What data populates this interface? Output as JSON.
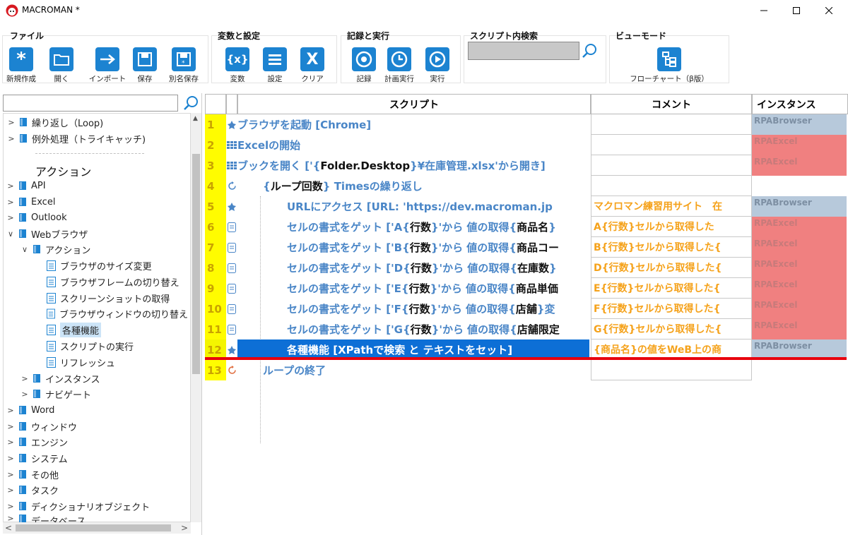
{
  "window": {
    "title": "MACROMAN *"
  },
  "ribbon": {
    "file_group": {
      "title": "ファイル",
      "buttons": [
        "新規作成",
        "開く",
        "インポート",
        "保存",
        "別名保存"
      ]
    },
    "var_group": {
      "title": "変数と設定",
      "buttons": [
        "変数",
        "設定",
        "クリア"
      ]
    },
    "rec_group": {
      "title": "記録と実行",
      "buttons": [
        "記録",
        "計画実行",
        "実行"
      ]
    },
    "search_group": {
      "title": "スクリプト内検索",
      "value": ""
    },
    "view_group": {
      "title": "ビューモード",
      "button": "フローチャート（β版）"
    }
  },
  "tree": {
    "search_value": "",
    "top_items": [
      "繰り返し（Loop)",
      "例外処理（トライキャッチ)"
    ],
    "heading": "アクション",
    "categories": [
      "API",
      "Excel",
      "Outlook",
      "Webブラウザ"
    ],
    "web_action_folder": "アクション",
    "web_actions": [
      "ブラウザのサイズ変更",
      "ブラウザフレームの切り替え",
      "スクリーンショットの取得",
      "ブラウザウィンドウの切り替え",
      "各種機能",
      "スクリプトの実行",
      "リフレッシュ"
    ],
    "web_sub": [
      "インスタンス",
      "ナビゲート"
    ],
    "more_categories": [
      "Word",
      "ウィンドウ",
      "エンジン",
      "システム",
      "その他",
      "タスク",
      "ディクショナリオブジェクト",
      "データベース"
    ]
  },
  "grid": {
    "headers": {
      "script": "スクリプト",
      "comment": "コメント",
      "instance": "インスタンス"
    },
    "rows": [
      {
        "num": "1",
        "script": "ブラウザを起動 [Chrome]",
        "comment": "",
        "instance": "RPABrowser"
      },
      {
        "num": "2",
        "script": "Excelの開始",
        "comment": "",
        "instance": "RPAExcel"
      },
      {
        "num": "3",
        "script_a": "ブックを開く ['{",
        "script_b": "Folder.Desktop",
        "script_c": "}¥在庫管理.xlsx'から開き]",
        "comment": "",
        "instance": "RPAExcel"
      },
      {
        "num": "4",
        "script_a": "{",
        "script_b": "ループ回数",
        "script_c": "} Timesの繰り返し",
        "comment": "",
        "instance": ""
      },
      {
        "num": "5",
        "script": "URLにアクセス [URL: 'https://dev.macroman.jp",
        "comment": "マクロマン練習用サイト　在",
        "instance": "RPABrowser"
      },
      {
        "num": "6",
        "script_a": "セルの書式をゲット ['A{",
        "script_b": "行数",
        "script_c": "}'から 値の取得{",
        "script_d": "商品名",
        "script_e": "}",
        "comment": "A{行数}セルから取得した",
        "instance": "RPAExcel"
      },
      {
        "num": "7",
        "script_a": "セルの書式をゲット ['B{",
        "script_b": "行数",
        "script_c": "}'から 値の取得{",
        "script_d": "商品コー",
        "script_e": "",
        "comment": "B{行数}セルから取得した{",
        "instance": "RPAExcel"
      },
      {
        "num": "8",
        "script_a": "セルの書式をゲット ['D{",
        "script_b": "行数",
        "script_c": "}'から 値の取得{",
        "script_d": "在庫数",
        "script_e": "}",
        "comment": "D{行数}セルから取得した{",
        "instance": "RPAExcel"
      },
      {
        "num": "9",
        "script_a": "セルの書式をゲット ['E{",
        "script_b": "行数",
        "script_c": "}'から 値の取得{",
        "script_d": "商品単価",
        "script_e": "",
        "comment": "E{行数}セルから取得した{",
        "instance": "RPAExcel"
      },
      {
        "num": "10",
        "script_a": "セルの書式をゲット ['F{",
        "script_b": "行数",
        "script_c": "}'から 値の取得{",
        "script_d": "店舗",
        "script_e": "}変",
        "comment": "F{行数}セルから取得した{",
        "instance": "RPAExcel"
      },
      {
        "num": "11",
        "script_a": "セルの書式をゲット ['G{",
        "script_b": "行数",
        "script_c": "}'から 値の取得{",
        "script_d": "店舗限定",
        "script_e": "",
        "comment": "G{行数}セルから取得した{",
        "instance": "RPAExcel"
      },
      {
        "num": "12",
        "script": "各種機能 [XPathで検索 と テキストをセット]",
        "comment": "{商品名}の値をWeB上の商",
        "instance": "RPABrowser"
      },
      {
        "num": "13",
        "script": "ループの終了",
        "comment": "",
        "instance": ""
      }
    ]
  },
  "colors": {
    "accent": "#1c83d1",
    "line_number_bg": "#fffc00",
    "selected_row": "#0d6fd6",
    "comment_text": "#f5a21b",
    "script_text": "#4a86c7",
    "browser_instance": "#b7c9db",
    "excel_instance": "#f08080",
    "marker_line": "#e8000d"
  }
}
